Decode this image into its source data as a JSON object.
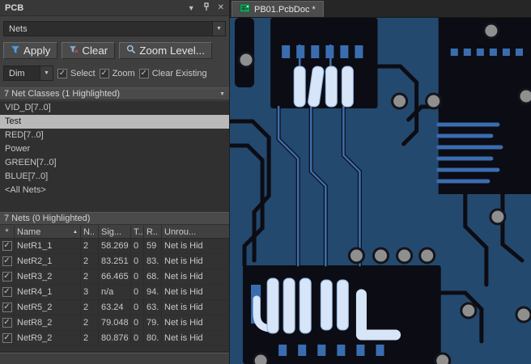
{
  "panel": {
    "title": "PCB",
    "nets_combo": "Nets",
    "buttons": {
      "apply": "Apply",
      "clear": "Clear",
      "zoom": "Zoom Level..."
    },
    "dim_combo": "Dim",
    "options": [
      {
        "label": "Select",
        "checked": true
      },
      {
        "label": "Zoom",
        "checked": true
      },
      {
        "label": "Clear Existing",
        "checked": true
      }
    ],
    "classes_header": "7 Net Classes (1 Highlighted)",
    "classes": [
      {
        "label": "VID_D[7..0]",
        "selected": false
      },
      {
        "label": "Test",
        "selected": true
      },
      {
        "label": "RED[7..0]",
        "selected": false
      },
      {
        "label": "Power",
        "selected": false
      },
      {
        "label": "GREEN[7..0]",
        "selected": false
      },
      {
        "label": "BLUE[7..0]",
        "selected": false
      },
      {
        "label": "<All Nets>",
        "selected": false
      }
    ],
    "nets_header": "7 Nets (0 Highlighted)",
    "table": {
      "columns": [
        "*",
        "Name",
        "N..",
        "Sig...",
        "T...",
        "R..",
        "Unrou..."
      ],
      "rows": [
        [
          "NetR1_1",
          "2",
          "58.269",
          "0",
          "59",
          "Net is Hid"
        ],
        [
          "NetR2_1",
          "2",
          "83.251",
          "0",
          "83.",
          "Net is Hid"
        ],
        [
          "NetR3_2",
          "2",
          "66.465",
          "0",
          "68.",
          "Net is Hid"
        ],
        [
          "NetR4_1",
          "3",
          "n/a",
          "0",
          "94.",
          "Net is Hid"
        ],
        [
          "NetR5_2",
          "2",
          "63.24",
          "0",
          "63.",
          "Net is Hid"
        ],
        [
          "NetR8_2",
          "2",
          "79.048",
          "0",
          "79.",
          "Net is Hid"
        ],
        [
          "NetR9_2",
          "2",
          "80.876",
          "0",
          "80.",
          "Net is Hid"
        ]
      ]
    }
  },
  "editor": {
    "tab_label": "PB01.PcbDoc *"
  },
  "icons": {
    "dropdown": "▼",
    "collapse": "▼",
    "close": "✕",
    "check": "✓",
    "sort_asc": "▲",
    "header_drop": "▼"
  },
  "colors": {
    "copper_pour": "#24496e",
    "board_black": "#0c0c14",
    "trace_blue": "#3a6db0",
    "highlight_pad": "#d6e5f8",
    "via_gray": "#8f8f8f",
    "panel_bg": "#3f3f3f",
    "selection_bg": "#b9b9b9"
  }
}
